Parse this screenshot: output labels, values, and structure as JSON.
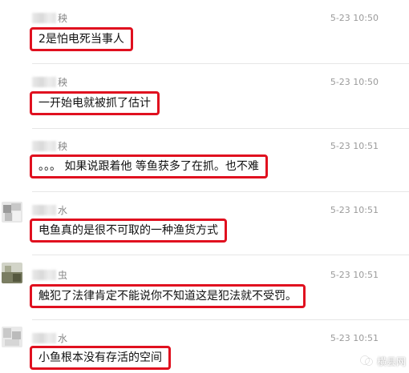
{
  "comments": [
    {
      "name_visible": "秧",
      "time": "5-23 10:50",
      "text": "2是怕电死当事人"
    },
    {
      "name_visible": "秧",
      "time": "5-23 10:50",
      "text": "一开始电就被抓了估计"
    },
    {
      "name_visible": "秧",
      "time": "5-23 10:51",
      "text": "。。。 如果说跟着他 等鱼获多了在抓。也不难"
    },
    {
      "name_visible": "水",
      "time": "5-23 10:51",
      "text": "电鱼真的是很不可取的一种渔货方式"
    },
    {
      "name_visible": "虫",
      "time": "5-23 10:51",
      "text": "触犯了法律肯定不能说你不知道这是犯法就不受罚。"
    },
    {
      "name_visible": "水",
      "time": "5-23 10:51",
      "text": "小鱼根本没有存活的空间"
    }
  ],
  "watermark": {
    "text": "横县网"
  },
  "colors": {
    "highlight_border": "#e0101f",
    "time_text": "#9a9a9a",
    "name_text": "#888888",
    "divider": "#e6e6e6"
  }
}
